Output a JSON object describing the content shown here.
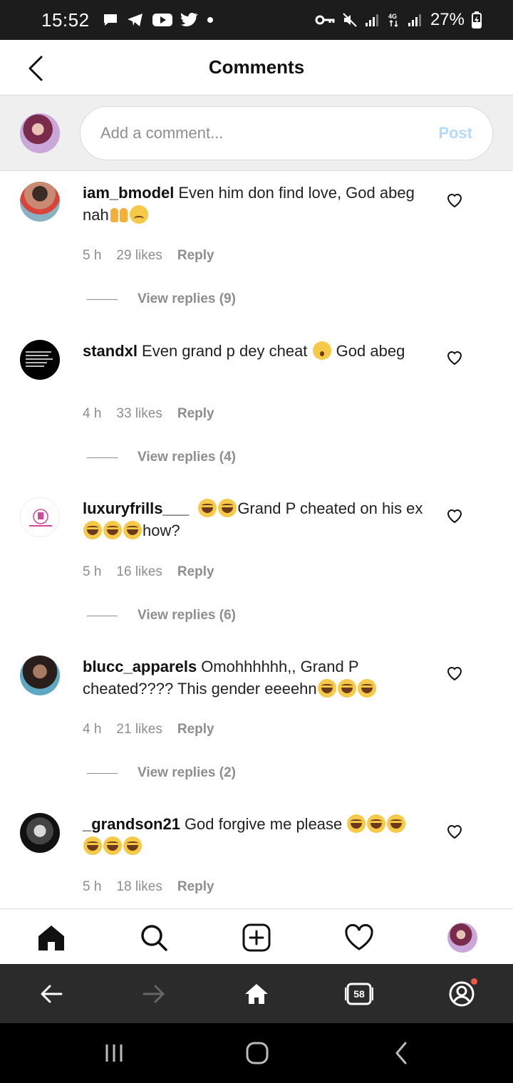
{
  "status_bar": {
    "time": "15:52",
    "battery": "27%",
    "network": "4G"
  },
  "header": {
    "title": "Comments"
  },
  "composer": {
    "placeholder": "Add a comment...",
    "post_label": "Post"
  },
  "comments": [
    {
      "username": "iam_bmodel",
      "text": "Even him don find love, God abeg nah",
      "emojis": [
        "hands",
        "sad"
      ],
      "time": "5 h",
      "likes": "29 likes",
      "reply": "Reply",
      "view_replies": "View replies (9)"
    },
    {
      "username": "standxl",
      "text_before": "Even grand p dey cheat",
      "emoji_mid": "hush",
      "text_after": "God abeg",
      "time": "4 h",
      "likes": "33 likes",
      "reply": "Reply",
      "view_replies": "View replies (4)"
    },
    {
      "username": "luxuryfrills___",
      "text_before": "",
      "text_mid": "Grand P cheated on his ex",
      "text_after": "how?",
      "time": "5 h",
      "likes": "16 likes",
      "reply": "Reply",
      "view_replies": "View replies (6)"
    },
    {
      "username": "blucc_apparels",
      "text": "Omohhhhhh,, Grand P cheated???? This gender eeeehn",
      "time": "4 h",
      "likes": "21 likes",
      "reply": "Reply",
      "view_replies": "View replies (2)"
    },
    {
      "username": "_grandson21",
      "text": "God forgive me please",
      "time": "5 h",
      "likes": "18 likes",
      "reply": "Reply"
    }
  ],
  "browser_nav": {
    "tab_count": "58"
  },
  "colors": {
    "post_disabled": "#b3dbff",
    "muted_text": "#8e8e8e",
    "status_bar_bg": "#1c1c1c",
    "browser_nav_bg": "#2b2b2b",
    "notification_dot": "#f05a45"
  }
}
